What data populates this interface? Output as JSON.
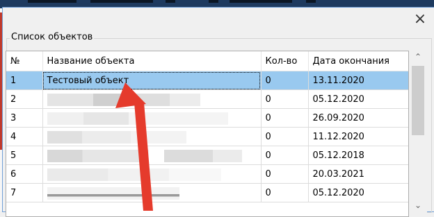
{
  "window": {
    "close_glyph": "×"
  },
  "group": {
    "title": "Список объектов"
  },
  "table": {
    "columns": [
      {
        "label": "№"
      },
      {
        "label": "Название объекта"
      },
      {
        "label": "Кол-во"
      },
      {
        "label": "Дата окончания"
      }
    ],
    "rows": [
      {
        "num": "1",
        "name": "Тестовый объект",
        "qty": "0",
        "date": "13.11.2020",
        "selected": true
      },
      {
        "num": "2",
        "name": "",
        "qty": "0",
        "date": "05.12.2020"
      },
      {
        "num": "3",
        "name": "",
        "qty": "0",
        "date": "26.09.2020"
      },
      {
        "num": "4",
        "name": "",
        "qty": "0",
        "date": "11.12.2020"
      },
      {
        "num": "5",
        "name": "",
        "qty": "0",
        "date": "05.12.2018"
      },
      {
        "num": "6",
        "name": "",
        "qty": "0",
        "date": "20.03.2021"
      },
      {
        "num": "7",
        "name": "",
        "qty": "0",
        "date": "05.12.2020"
      }
    ]
  },
  "scrollbar": {
    "up_glyph": "⌃",
    "down_glyph": "⌄"
  },
  "annotation": {
    "arrow_color": "#e53b2c"
  }
}
